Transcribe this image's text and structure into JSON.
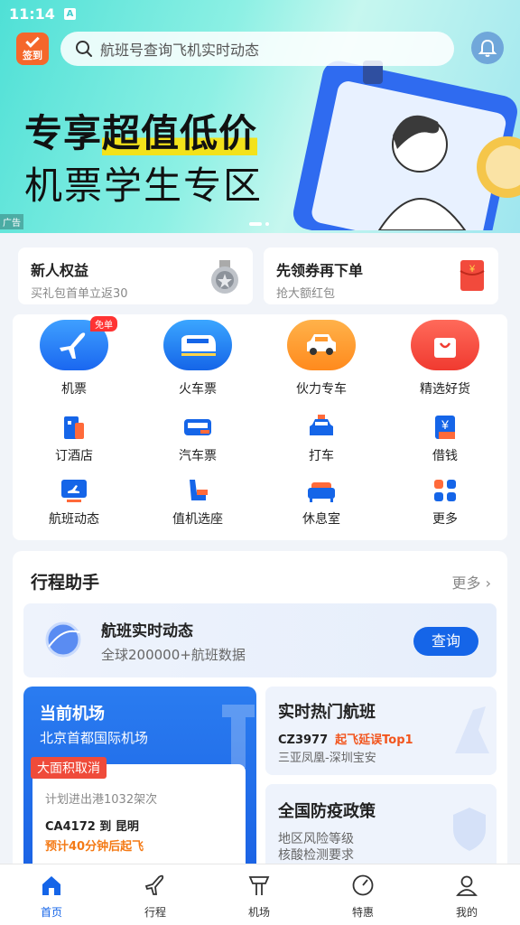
{
  "status": {
    "time": "11:14",
    "indicator": "A"
  },
  "header": {
    "checkin_label": "签到",
    "search_placeholder": "航班号查询飞机实时动态"
  },
  "banner": {
    "line1_a": "专享",
    "line1_b": "超值低价",
    "line2": "机票学生专区",
    "ad_label": "广告"
  },
  "promos": [
    {
      "title": "新人权益",
      "subtitle": "买礼包首单立返30"
    },
    {
      "title": "先领券再下单",
      "subtitle": "抢大额红包"
    }
  ],
  "main_services": [
    {
      "label": "机票",
      "badge": "免单"
    },
    {
      "label": "火车票"
    },
    {
      "label": "伙力专车"
    },
    {
      "label": "精选好货"
    }
  ],
  "sub_services_row1": [
    {
      "label": "订酒店"
    },
    {
      "label": "汽车票"
    },
    {
      "label": "打车"
    },
    {
      "label": "借钱"
    }
  ],
  "sub_services_row2": [
    {
      "label": "航班动态"
    },
    {
      "label": "值机选座"
    },
    {
      "label": "休息室"
    },
    {
      "label": "更多"
    }
  ],
  "assistant": {
    "title": "行程助手",
    "more": "更多 ›",
    "flight_status": {
      "title": "航班实时动态",
      "subtitle": "全球200000+航班数据",
      "button": "查询"
    },
    "airport": {
      "title": "当前机场",
      "name": "北京首都国际机场",
      "tag": "大面积取消",
      "plan": "计划进出港1032架次",
      "flight": "CA4172 到 昆明",
      "delay": "预计40分钟后起飞"
    },
    "hot": {
      "title": "实时热门航班",
      "flight": "CZ3977",
      "rank": "起飞延误Top1",
      "route": "三亚凤凰-深圳宝安"
    },
    "covid": {
      "title": "全国防疫政策",
      "item1": "地区风险等级",
      "item2": "核酸检测要求"
    }
  },
  "tabs": [
    {
      "label": "首页",
      "active": true
    },
    {
      "label": "行程"
    },
    {
      "label": "机场"
    },
    {
      "label": "特惠"
    },
    {
      "label": "我的"
    }
  ],
  "colors": {
    "primary": "#1565e8",
    "orange": "#f5672b",
    "red": "#ef4b3a"
  }
}
